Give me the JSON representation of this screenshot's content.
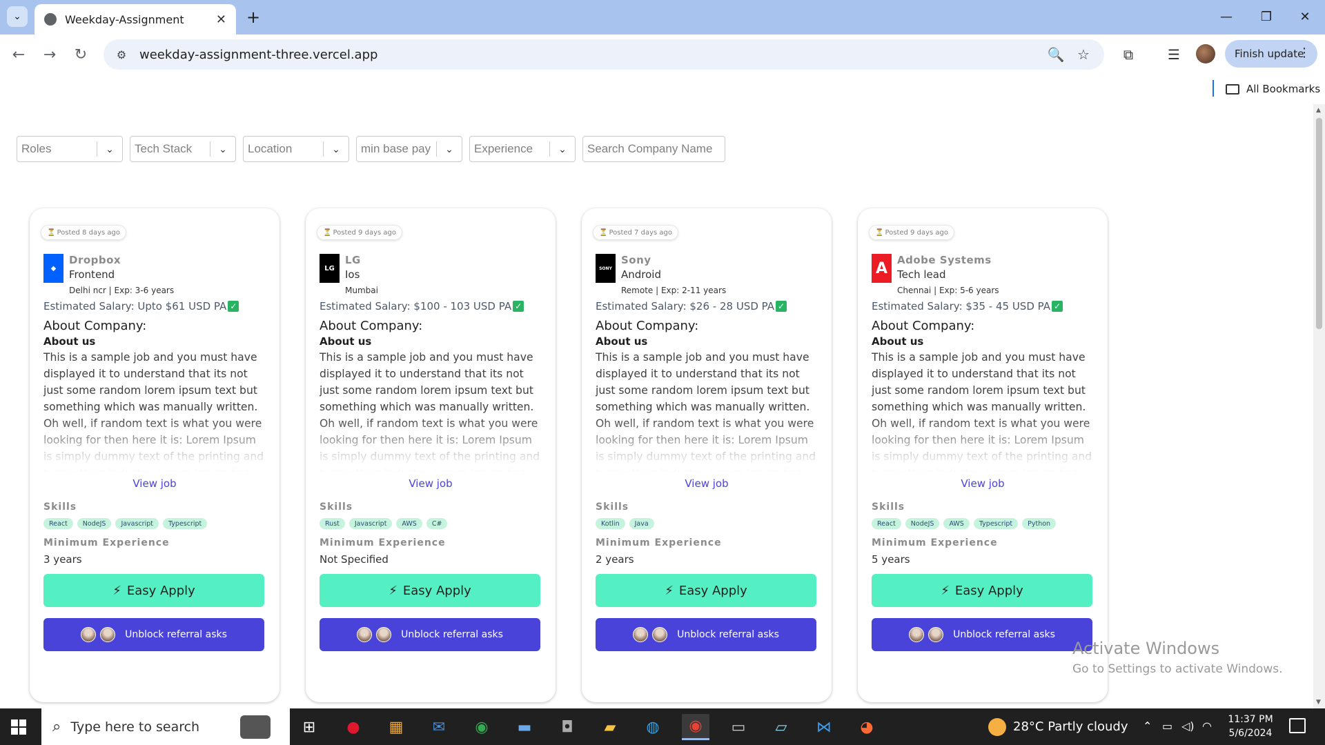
{
  "browser": {
    "tab_title": "Weekday-Assignment",
    "tab_close": "✕",
    "new_tab": "+",
    "url": "weekday-assignment-three.vercel.app",
    "finish_update": "Finish update",
    "all_bookmarks": "All Bookmarks"
  },
  "filters": {
    "roles": "Roles",
    "tech_stack": "Tech Stack",
    "location": "Location",
    "min_base_pay": "min base pay",
    "experience": "Experience",
    "search_placeholder": "Search Company Name"
  },
  "jobs": [
    {
      "posted": "Posted 8 days ago",
      "company": "Dropbox",
      "role": "Frontend",
      "location_exp": "Delhi ncr | Exp: 3-6 years",
      "salary": "Estimated Salary: Upto $61 USD PA",
      "about_heading": "About Company:",
      "about_sub": "About us",
      "description": "This is a sample job and you must have displayed it to understand that its not just some random lorem ipsum text but something which was manually written. Oh well, if random text is what you were looking for then here it is: Lorem Ipsum is simply dummy text of the printing and typesetting industry. Lorem Ipsum has been the industry's standard dummy text ever since the 1500s, when an unknown",
      "view_job": "View job",
      "skills_heading": "Skills",
      "skills": [
        "React",
        "NodeJS",
        "Javascript",
        "Typescript"
      ],
      "min_exp_heading": "Minimum Experience",
      "min_exp": "3 years",
      "easy_apply": "Easy Apply",
      "referral": "Unblock referral asks",
      "logo_color": "#0061fe",
      "logo_text": "◆"
    },
    {
      "posted": "Posted 9 days ago",
      "company": "LG",
      "role": "Ios",
      "location_exp": "Mumbai",
      "salary": "Estimated Salary: $100 - 103 USD PA",
      "about_heading": "About Company:",
      "about_sub": "About us",
      "description": "This is a sample job and you must have displayed it to understand that its not just some random lorem ipsum text but something which was manually written. Oh well, if random text is what you were looking for then here it is: Lorem Ipsum is simply dummy text of the printing and typesetting industry. Lorem Ipsum has been the industry's standard dummy text ever since the 1500s, when an unknown",
      "view_job": "View job",
      "skills_heading": "Skills",
      "skills": [
        "Rust",
        "Javascript",
        "AWS",
        "C#"
      ],
      "min_exp_heading": "Minimum Experience",
      "min_exp": "Not Specified",
      "easy_apply": "Easy Apply",
      "referral": "Unblock referral asks",
      "logo_color": "#000000",
      "logo_text": "LG"
    },
    {
      "posted": "Posted 7 days ago",
      "company": "Sony",
      "role": "Android",
      "location_exp": "Remote | Exp: 2-11 years",
      "salary": "Estimated Salary: $26 - 28 USD PA",
      "about_heading": "About Company:",
      "about_sub": "About us",
      "description": "This is a sample job and you must have displayed it to understand that its not just some random lorem ipsum text but something which was manually written. Oh well, if random text is what you were looking for then here it is: Lorem Ipsum is simply dummy text of the printing and typesetting industry. Lorem Ipsum has been the industry's standard dummy text ever since the 1500s, when an unknown",
      "view_job": "View job",
      "skills_heading": "Skills",
      "skills": [
        "Kotlin",
        "Java"
      ],
      "min_exp_heading": "Minimum Experience",
      "min_exp": "2 years",
      "easy_apply": "Easy Apply",
      "referral": "Unblock referral asks",
      "logo_color": "#000000",
      "logo_text": "SONY"
    },
    {
      "posted": "Posted 9 days ago",
      "company": "Adobe Systems",
      "role": "Tech lead",
      "location_exp": "Chennai | Exp: 5-6 years",
      "salary": "Estimated Salary: $35 - 45 USD PA",
      "about_heading": "About Company:",
      "about_sub": "About us",
      "description": "This is a sample job and you must have displayed it to understand that its not just some random lorem ipsum text but something which was manually written. Oh well, if random text is what you were looking for then here it is: Lorem Ipsum is simply dummy text of the printing and typesetting industry. Lorem Ipsum has been the industry's standard dummy text ever since the 1500s, when an unknown",
      "view_job": "View job",
      "skills_heading": "Skills",
      "skills": [
        "React",
        "NodeJS",
        "AWS",
        "Typescript",
        "Python"
      ],
      "min_exp_heading": "Minimum Experience",
      "min_exp": "5 years",
      "easy_apply": "Easy Apply",
      "referral": "Unblock referral asks",
      "logo_color": "#ec1c24",
      "logo_text": "A"
    }
  ],
  "watermark": {
    "line1": "Activate Windows",
    "line2": "Go to Settings to activate Windows."
  },
  "taskbar": {
    "search_text": "Type here to search",
    "weather": "28°C  Partly cloudy",
    "time": "11:37 PM",
    "date": "5/6/2024"
  }
}
